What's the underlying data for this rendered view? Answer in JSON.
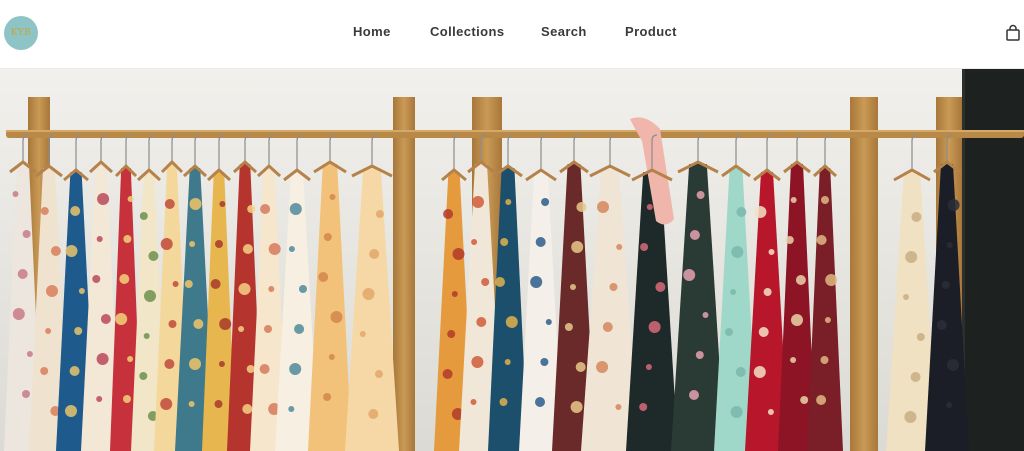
{
  "header": {
    "logo_text": "KYB",
    "nav": [
      {
        "label": "Home"
      },
      {
        "label": "Collections"
      },
      {
        "label": "Search"
      },
      {
        "label": "Product"
      }
    ],
    "cart_icon": "shopping-bag-icon"
  },
  "hero": {
    "image": "clothing-rack-photo"
  },
  "colors": {
    "logo_bg": "#8ec4c6",
    "logo_text": "#c9a437",
    "nav_text": "#3a3a3a",
    "wall": "#ecebe7",
    "wood": "#b98a47"
  }
}
